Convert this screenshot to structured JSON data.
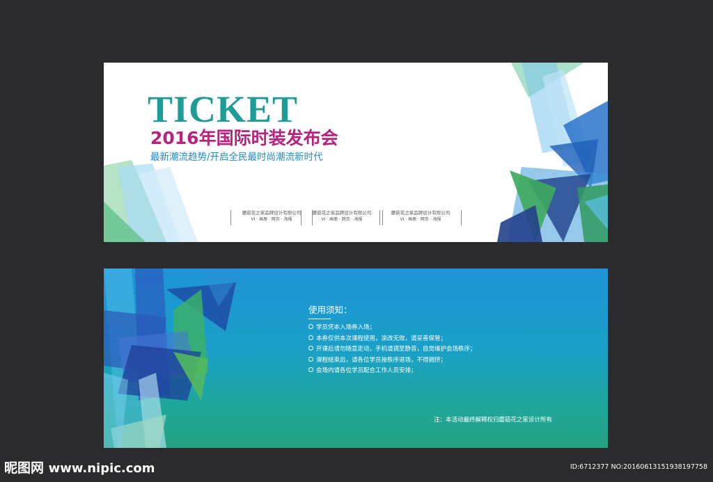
{
  "colors": {
    "background": "#2b2b2d",
    "title_teal": "#1f9c95",
    "subtitle_magenta": "#b5237f",
    "tagline_blue": "#1c8bc6",
    "back_gradient_top": "#1e93d6",
    "back_gradient_bottom": "#24a27f"
  },
  "front": {
    "title": "TICKET",
    "subtitle": "2016年国际时装发布会",
    "tagline": "最新潮流趋势/开启全民最时尚潮流新时代",
    "companies": [
      {
        "name": "蘑菇花之家品牌设计有限公司",
        "services": "VI · 画册 · 网页 · 海报"
      },
      {
        "name": "蘑菇花之家品牌设计有限公司",
        "services": "VI · 画册 · 网页 · 海报"
      },
      {
        "name": "蘑菇花之家品牌设计有限公司",
        "services": "VI · 画册 · 网页 · 海报"
      }
    ]
  },
  "back": {
    "notice_title": "使用须知：",
    "notice_items": [
      "学员凭本入场券入场；",
      "本券仅供本次课程使用，涂改无效，请妥善保管；",
      "开课后请勿随意走动，手机请调至静音，自觉维护会场秩序；",
      "课程结束后，请各位学员按秩序退场，不得拥挤；",
      "会场内请各位学员配合工作人员安排；"
    ],
    "footnote": "注：本活动最终解释权归蘑菇花之家设计所有"
  },
  "watermark": {
    "logo": "昵图网",
    "url": "www.nipic.com",
    "id_text": "ID:6712377 NO:20160613151938197758"
  }
}
